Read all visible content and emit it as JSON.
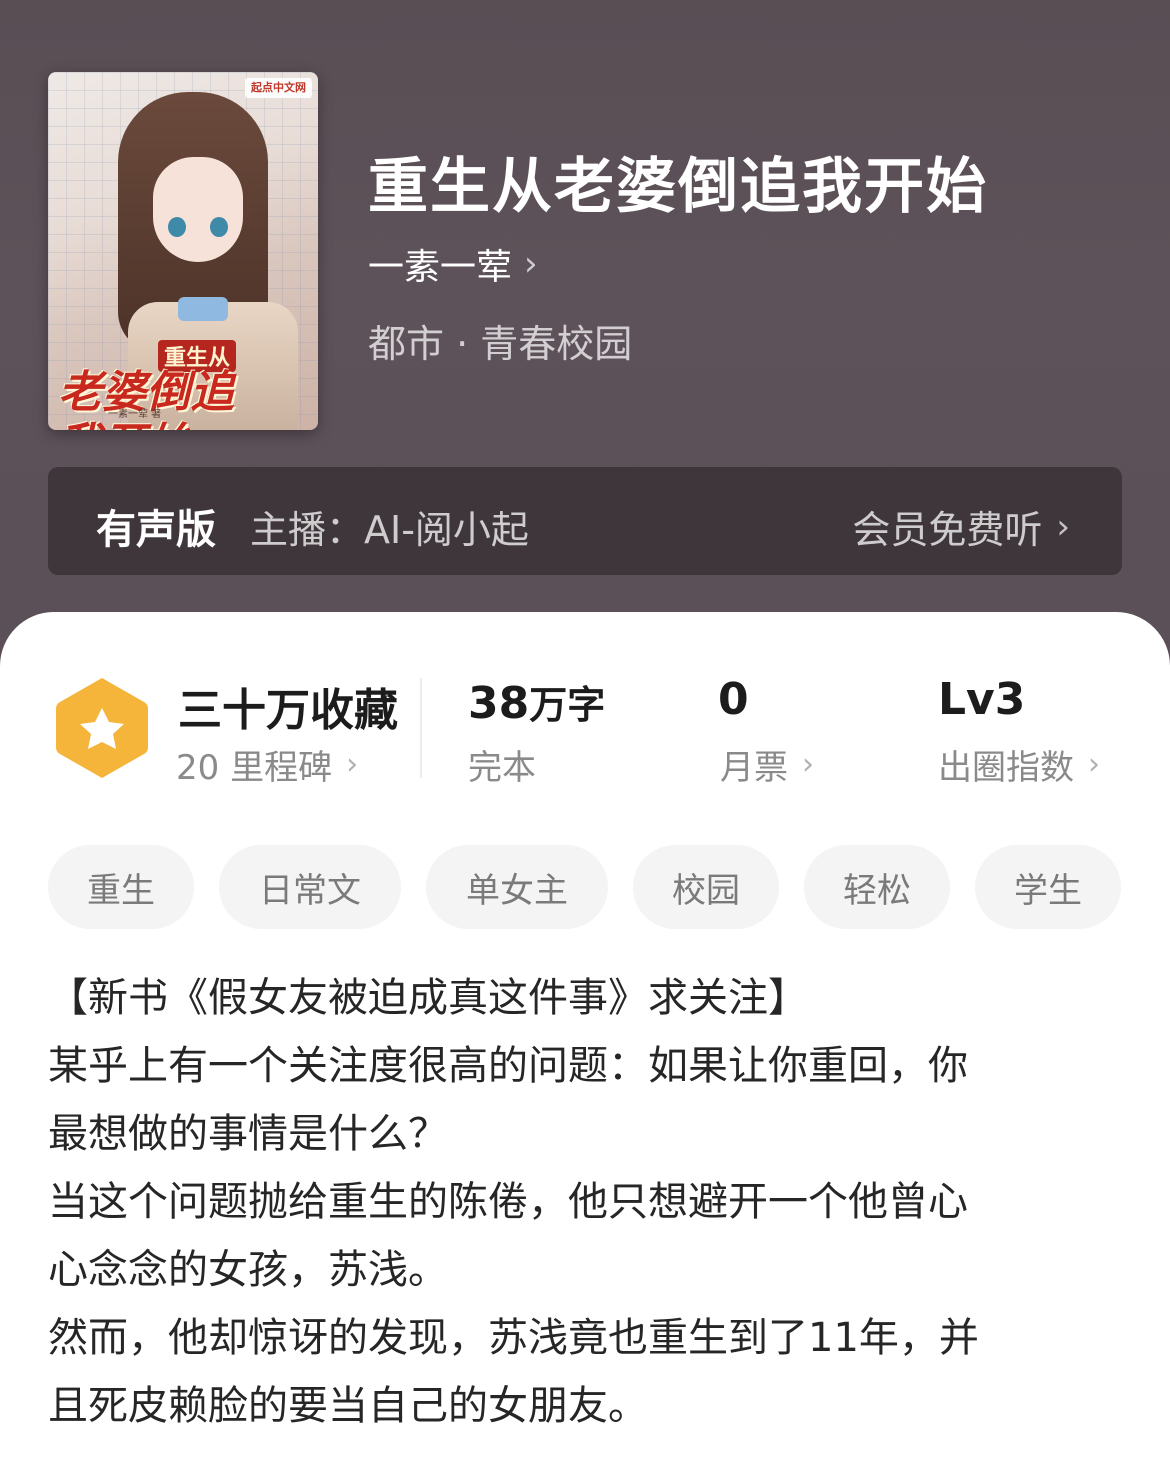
{
  "book": {
    "title": "重生从老婆倒追我开始",
    "author": "一素一荤",
    "genre": "都市 · 青春校园"
  },
  "cover": {
    "brand": "起点中文网",
    "title_small": "重生从",
    "title_line1": "老婆倒追",
    "title_line2": "我开始",
    "author_text": "一素一荤 著"
  },
  "audio": {
    "label": "有声版",
    "host": "主播：AI-阅小起",
    "action": "会员免费听"
  },
  "stats": {
    "favorites": {
      "main": "三十万收藏",
      "sub": "20 里程碑"
    },
    "words": {
      "number": "38",
      "unit": "万字",
      "sub": "完本"
    },
    "tickets": {
      "main": "0",
      "sub": "月票"
    },
    "level": {
      "main": "Lv3",
      "sub": "出圈指数"
    }
  },
  "tags": [
    "重生",
    "日常文",
    "单女主",
    "校园",
    "轻松",
    "学生"
  ],
  "synopsis": [
    "【新书《假女友被迫成真这件事》求关注】",
    "某乎上有一个关注度很高的问题：如果让你重回，你",
    "最想做的事情是什么？",
    "当这个问题抛给重生的陈倦，他只想避开一个他曾心",
    "心念念的女孩，苏浅。",
    "然而，他却惊讶的发现，苏浅竟也重生到了11年，并",
    "且死皮赖脸的要当自己的女朋友。"
  ],
  "colors": {
    "hero_bg": "#5a4e55",
    "badge_orange": "#f5b43a",
    "text_dark": "#1c1c1c",
    "text_gray": "#8a8a8a",
    "tag_bg": "#f4f4f4"
  },
  "icons": {
    "badge": "star-hexagon-icon",
    "chevron": "chevron-right-icon"
  }
}
